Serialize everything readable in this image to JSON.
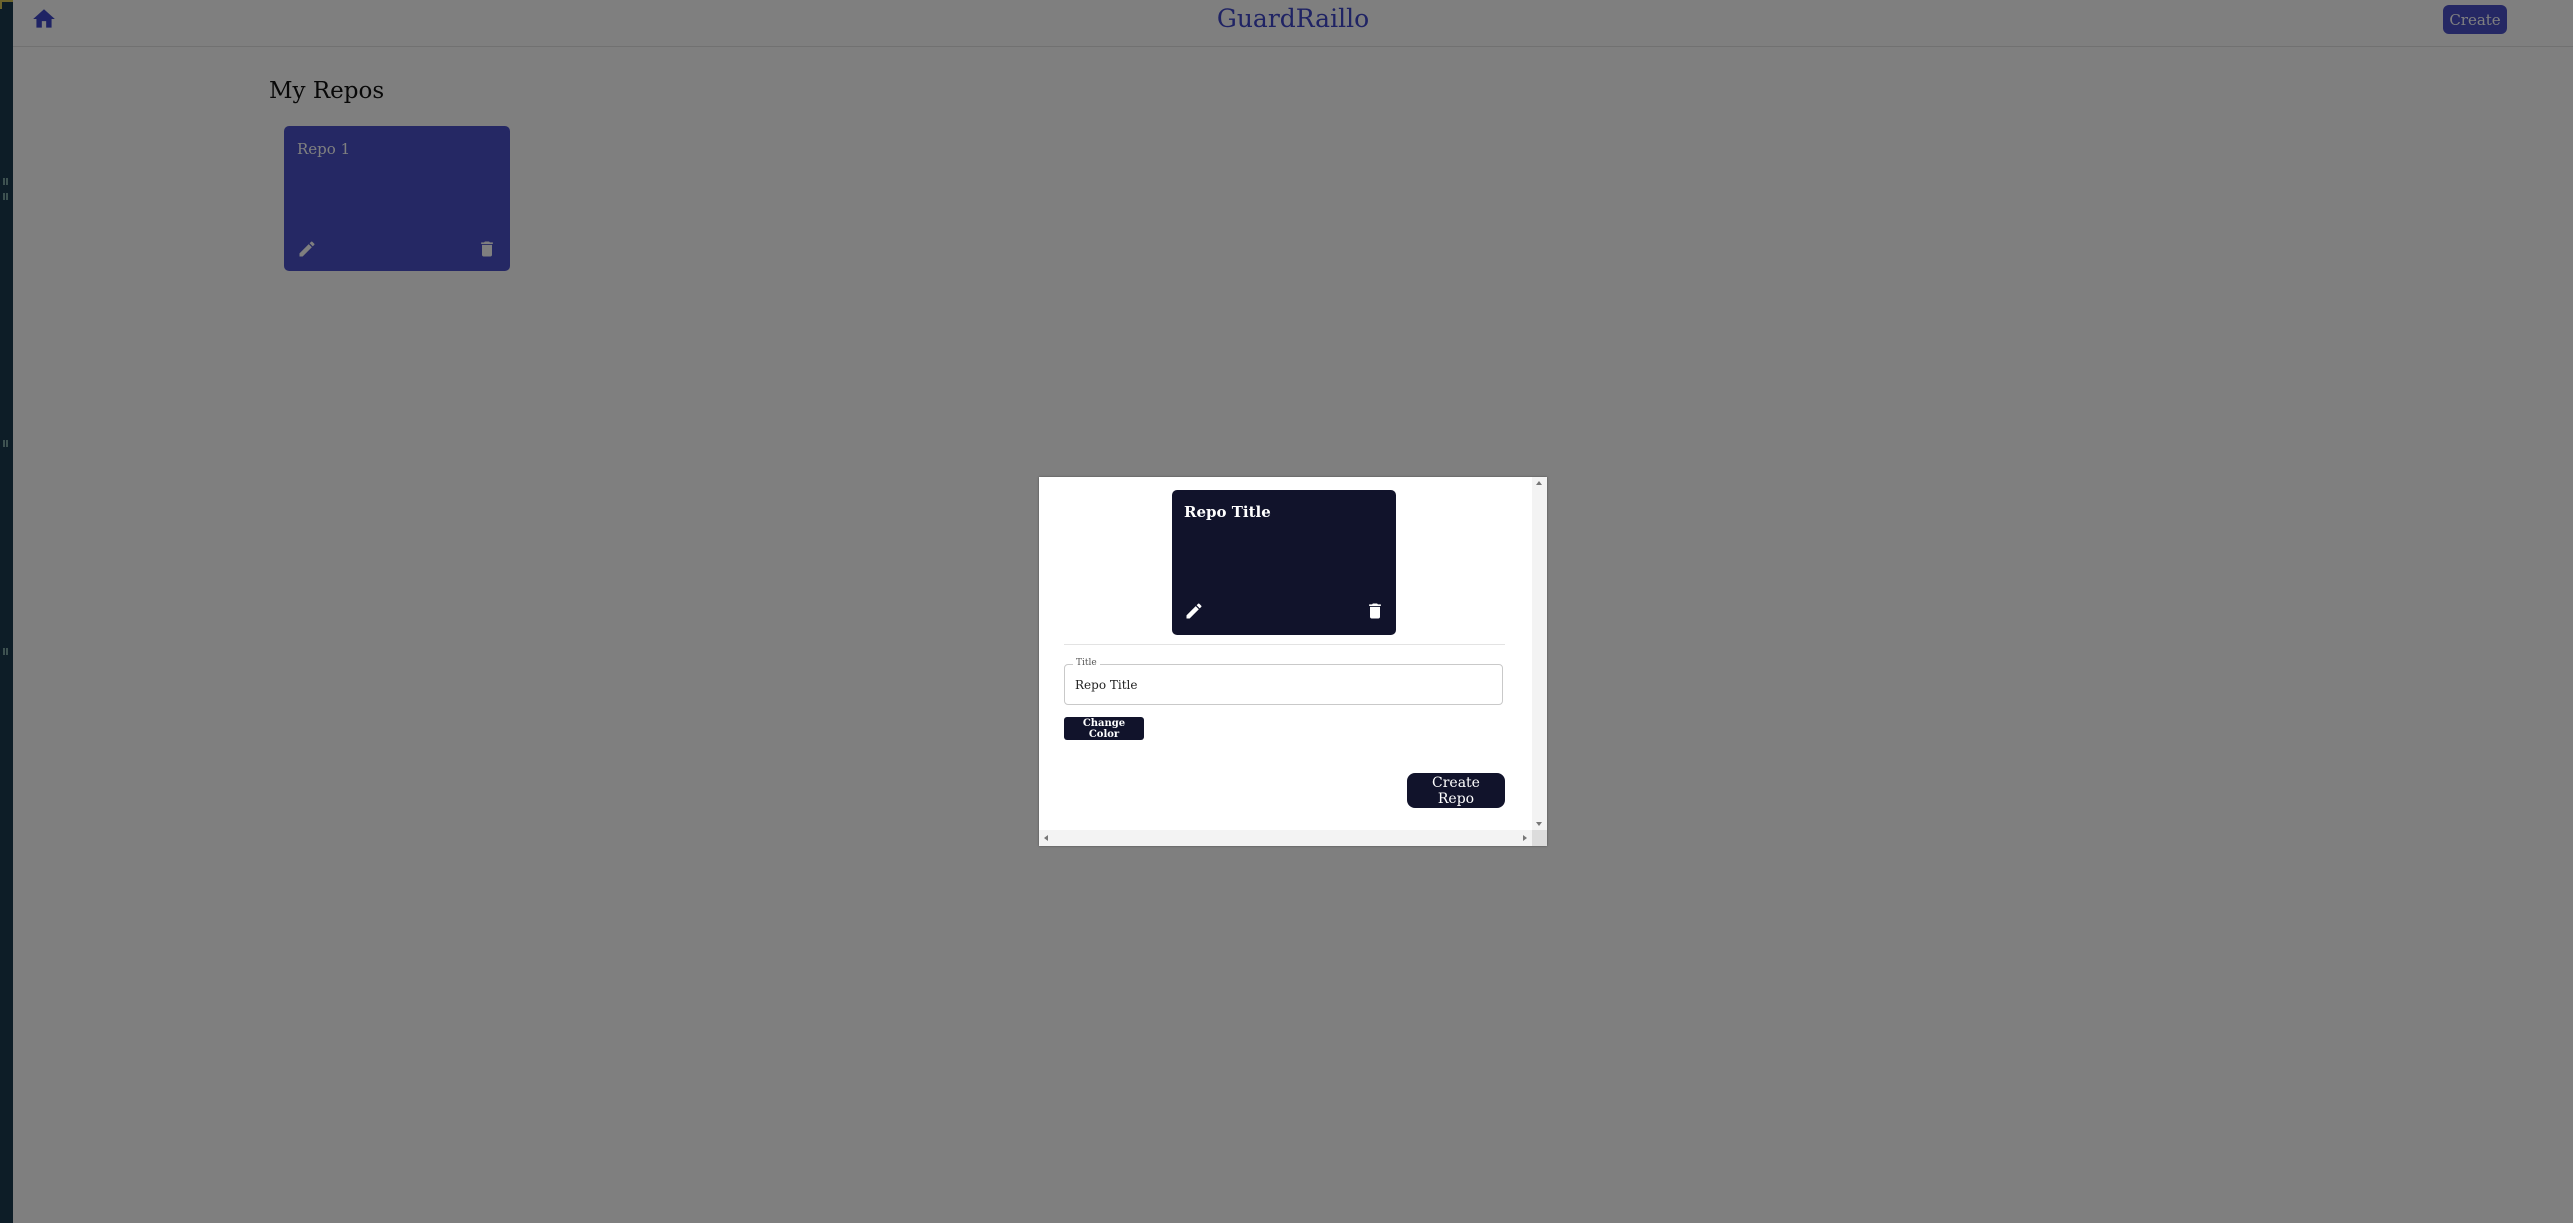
{
  "app": {
    "brand": "GuardRaillo",
    "create_label": "Create",
    "section_title": "My Repos",
    "repos": [
      {
        "title": "Repo 1",
        "color": "#4a51c9"
      }
    ]
  },
  "modal": {
    "preview_title": "Repo Title",
    "preview_color": "#11132b",
    "title_field": {
      "label": "Title",
      "value": "Repo Title"
    },
    "change_color_label": "Change Color",
    "submit_label": "Create Repo"
  },
  "icons": {
    "home": "home-icon",
    "edit": "pencil-icon",
    "delete": "trash-icon"
  },
  "colors": {
    "accent": "#4a51c9",
    "dark": "#11132b",
    "overlay": "rgba(0,0,0,0.5)"
  }
}
